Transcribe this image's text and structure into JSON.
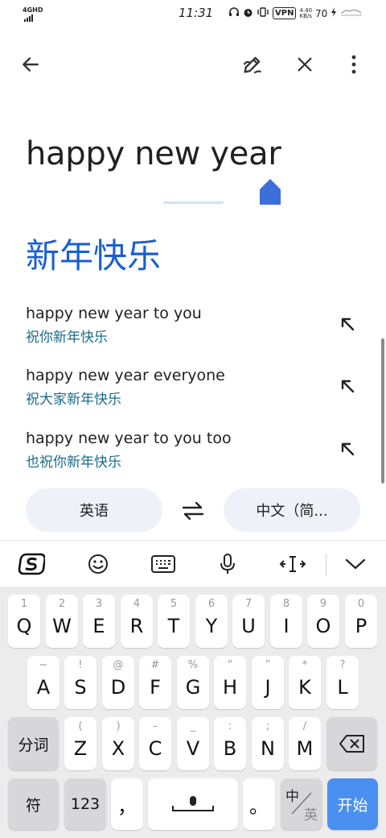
{
  "status_bar": {
    "network": "4GHD",
    "time": "11:31",
    "vpn": "VPN",
    "speed_value": "4.40",
    "speed_unit": "KB/s",
    "battery": "70"
  },
  "source_text": "happy new year",
  "translation": "新年快乐",
  "suggestions": [
    {
      "en": "happy new year to you",
      "zh": "祝你新年快乐"
    },
    {
      "en": "happy new year everyone",
      "zh": "祝大家新年快乐"
    },
    {
      "en": "happy new year to you too",
      "zh": "也祝你新年快乐"
    }
  ],
  "languages": {
    "source": "英语",
    "target": "中文（简..."
  },
  "keyboard": {
    "row1": [
      {
        "hint": "1",
        "key": "Q"
      },
      {
        "hint": "2",
        "key": "W"
      },
      {
        "hint": "3",
        "key": "E"
      },
      {
        "hint": "4",
        "key": "R"
      },
      {
        "hint": "5",
        "key": "T"
      },
      {
        "hint": "6",
        "key": "Y"
      },
      {
        "hint": "7",
        "key": "U"
      },
      {
        "hint": "8",
        "key": "I"
      },
      {
        "hint": "9",
        "key": "O"
      },
      {
        "hint": "0",
        "key": "P"
      }
    ],
    "row2": [
      {
        "hint": "~",
        "key": "A"
      },
      {
        "hint": "!",
        "key": "S"
      },
      {
        "hint": "@",
        "key": "D"
      },
      {
        "hint": "#",
        "key": "F"
      },
      {
        "hint": "%",
        "key": "G"
      },
      {
        "hint": "“",
        "key": "H"
      },
      {
        "hint": "”",
        "key": "J"
      },
      {
        "hint": "*",
        "key": "K"
      },
      {
        "hint": "?",
        "key": "L"
      }
    ],
    "row3": [
      {
        "hint": "(",
        "key": "Z"
      },
      {
        "hint": ")",
        "key": "X"
      },
      {
        "hint": "–",
        "key": "C"
      },
      {
        "hint": "_",
        "key": "V"
      },
      {
        "hint": ":",
        "key": "B"
      },
      {
        "hint": ";",
        "key": "N"
      },
      {
        "hint": "/",
        "key": "M"
      }
    ],
    "segment_label": "分词",
    "symbol_label": "符",
    "numbers_label": "123",
    "comma_label": "，",
    "period_label": "。",
    "lang_toggle_top": "中",
    "lang_toggle_bottom": "英",
    "start_label": "开始"
  },
  "colors": {
    "translation": "#1a5fcf",
    "accent": "#4a90f0"
  }
}
